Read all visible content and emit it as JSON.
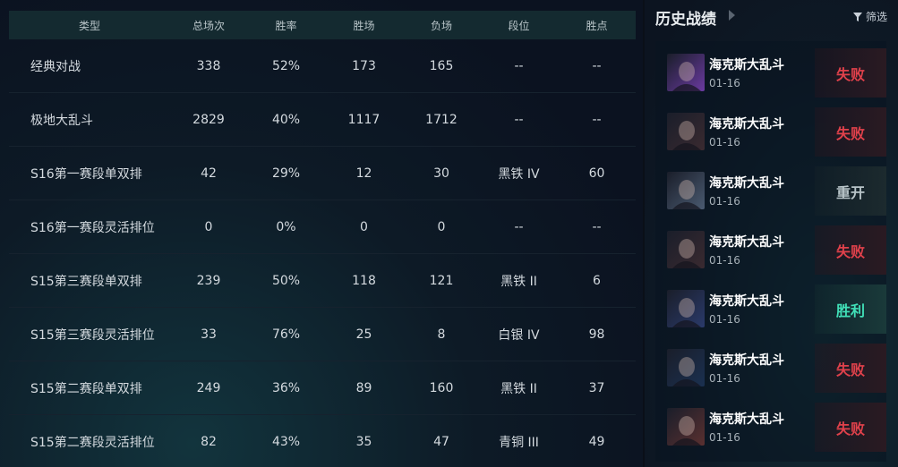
{
  "stats_table": {
    "headers": [
      "类型",
      "总场次",
      "胜率",
      "胜场",
      "负场",
      "段位",
      "胜点"
    ],
    "rows": [
      [
        "经典对战",
        "338",
        "52%",
        "173",
        "165",
        "--",
        "--"
      ],
      [
        "极地大乱斗",
        "2829",
        "40%",
        "1117",
        "1712",
        "--",
        "--"
      ],
      [
        "S16第一赛段单双排",
        "42",
        "29%",
        "12",
        "30",
        "黑铁 IV",
        "60"
      ],
      [
        "S16第一赛段灵活排位",
        "0",
        "0%",
        "0",
        "0",
        "--",
        "--"
      ],
      [
        "S15第三赛段单双排",
        "239",
        "50%",
        "118",
        "121",
        "黑铁 II",
        "6"
      ],
      [
        "S15第三赛段灵活排位",
        "33",
        "76%",
        "25",
        "8",
        "白银 IV",
        "98"
      ],
      [
        "S15第二赛段单双排",
        "249",
        "36%",
        "89",
        "160",
        "黑铁 II",
        "37"
      ],
      [
        "S15第二赛段灵活排位",
        "82",
        "43%",
        "35",
        "47",
        "青铜 III",
        "49"
      ]
    ]
  },
  "history": {
    "title": "历史战绩",
    "filter_label": "筛选",
    "matches": [
      {
        "mode": "海克斯大乱斗",
        "date": "01-16",
        "result": "失败",
        "result_type": "loss",
        "champ_color": "#6a3aa0",
        "champ_icon": "champion-portrait-icon"
      },
      {
        "mode": "海克斯大乱斗",
        "date": "01-16",
        "result": "失败",
        "result_type": "loss",
        "champ_color": "#3a2a30",
        "champ_icon": "champion-portrait-icon"
      },
      {
        "mode": "海克斯大乱斗",
        "date": "01-16",
        "result": "重开",
        "result_type": "remake",
        "champ_color": "#4a5a70",
        "champ_icon": "champion-portrait-icon"
      },
      {
        "mode": "海克斯大乱斗",
        "date": "01-16",
        "result": "失败",
        "result_type": "loss",
        "champ_color": "#3a2a30",
        "champ_icon": "champion-portrait-icon"
      },
      {
        "mode": "海克斯大乱斗",
        "date": "01-16",
        "result": "胜利",
        "result_type": "win",
        "champ_color": "#2a3a6a",
        "champ_icon": "champion-portrait-icon"
      },
      {
        "mode": "海克斯大乱斗",
        "date": "01-16",
        "result": "失败",
        "result_type": "loss",
        "champ_color": "#1a3050",
        "champ_icon": "champion-portrait-icon"
      },
      {
        "mode": "海克斯大乱斗",
        "date": "01-16",
        "result": "失败",
        "result_type": "loss",
        "champ_color": "#5a3030",
        "champ_icon": "champion-portrait-icon"
      }
    ]
  }
}
